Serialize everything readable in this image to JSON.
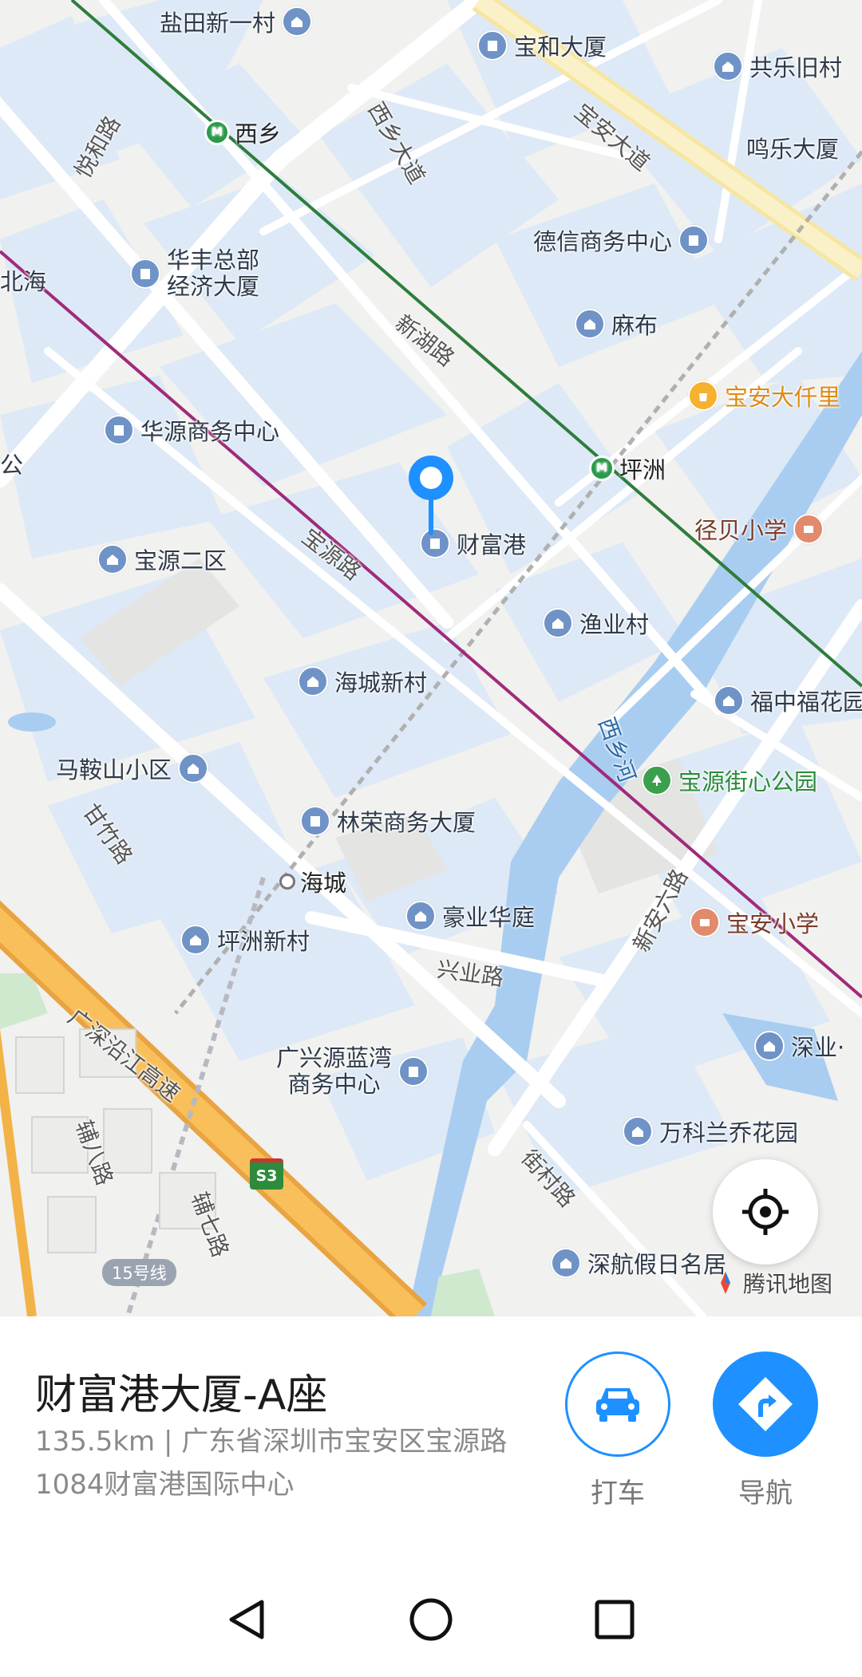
{
  "map": {
    "pois": {
      "yantian": "盐田新一村",
      "baohe": "宝和大厦",
      "gongle": "共乐旧村",
      "mingle": "鸣乐大厦",
      "dexin": "德信商务中心",
      "huafeng_line1": "华丰总部",
      "huafeng_line2": "经济大厦",
      "mabu": "麻布",
      "qianli": "宝安大仟里",
      "huayuan": "华源商务中心",
      "caifu": "财富港",
      "jingbei": "径贝小学",
      "baoyuan2": "宝源二区",
      "yuye": "渔业村",
      "haicheng_new": "海城新村",
      "fuzhong": "福中福花园",
      "maanshan": "马鞍山小区",
      "baoyuan_park": "宝源街心公园",
      "linrong": "林荣商务大厦",
      "haoye": "豪业华庭",
      "baoan_school": "宝安小学",
      "pingzhou_new": "坪洲新村",
      "guangxing_line1": "广兴源蓝湾",
      "guangxing_line2": "商务中心",
      "shenye": "深业·",
      "vanke": "万科兰乔花园",
      "shenhang": "深航假日名居",
      "beihai": "北海",
      "dong_left": "公"
    },
    "stations": {
      "xixiang": "西乡",
      "pingzhou": "坪洲",
      "haicheng": "海城"
    },
    "roads": {
      "xixiang_ave": "西乡大道",
      "baoan_ave": "宝安大道",
      "yuehe": "悦和路",
      "xinhu": "新湖路",
      "baoyuan": "宝源路",
      "xixiang_river": "西乡河",
      "ganzhu": "甘竹路",
      "xinyu": "兴业路",
      "xinan6": "新安六路",
      "guangshen_coast": "广深沿江高速",
      "fu8": "辅八路",
      "fu7": "辅七路",
      "jiecun": "街村路"
    },
    "highway_shield": "S3",
    "metro_line_tag": "15号线",
    "brand": "腾讯地图"
  },
  "place": {
    "title": "财富港大厦-A座",
    "address": "135.5km | 广东省深圳市宝安区宝源路1084财富港国际中心"
  },
  "actions": {
    "taxi": "打车",
    "navigate": "导航"
  },
  "colors": {
    "accent": "#1e90ff",
    "metro_green": "#2e7d3c",
    "metro_purple": "#a02a7a",
    "block_blue": "#dde9f6"
  }
}
